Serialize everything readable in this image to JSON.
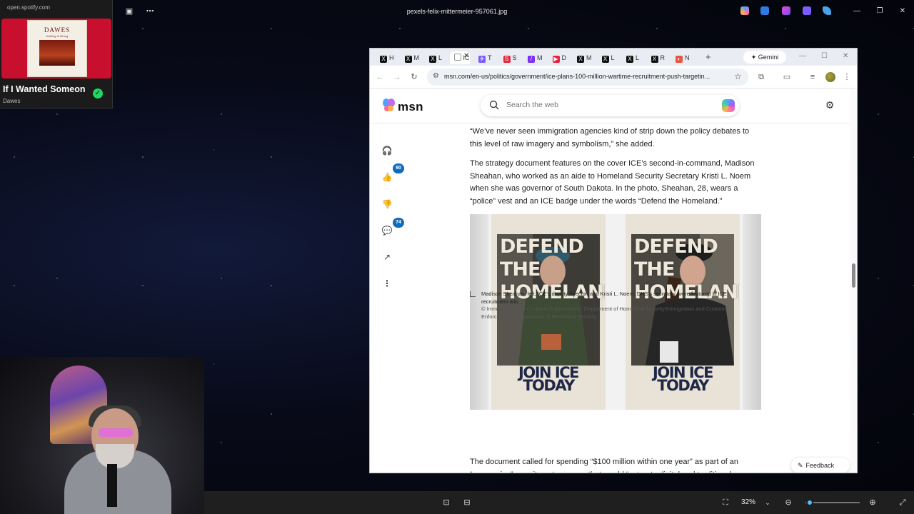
{
  "spotify": {
    "origin": "open.spotify.com",
    "album_band": "DAWES",
    "album_subtitle": "Nothing Is Wrong",
    "track": "If I Wanted Someone",
    "artist": "Dawes"
  },
  "viewer": {
    "file_title": "pexels-felix-mittermeier-957061.jpg",
    "zoom": "32%",
    "zoom_fraction": 0.08
  },
  "browser": {
    "tabs": [
      {
        "icon": "X",
        "label": "H"
      },
      {
        "icon": "X",
        "label": "M"
      },
      {
        "icon": "X",
        "label": "L"
      },
      {
        "icon": "",
        "label": "IC",
        "active": true
      },
      {
        "icon": "✈",
        "label": "T"
      },
      {
        "icon": "S",
        "label": "S"
      },
      {
        "icon": "/",
        "label": "M"
      },
      {
        "icon": "▶",
        "label": "D"
      },
      {
        "icon": "X",
        "label": "M"
      },
      {
        "icon": "X",
        "label": "L"
      },
      {
        "icon": "X",
        "label": "L"
      },
      {
        "icon": "X",
        "label": "R"
      },
      {
        "icon": "◐",
        "label": "N"
      }
    ],
    "gemini_label": "Gemini",
    "url": "msn.com/en-us/politics/government/ice-plans-100-million-wartime-recruitment-push-targetin..."
  },
  "msn": {
    "logo_text": "msn",
    "search_placeholder": "Search the web",
    "rail": {
      "like_count": "90",
      "comment_count": "74"
    },
    "article": {
      "p1": "“We’ve never seen immigration agencies kind of strip down the policy debates to this level of raw imagery and symbolism,” she added.",
      "p2": "The strategy document features on the cover ICE’s second-in-command, Madison Sheahan, who worked as an aide to Homeland Security Secretary Kristi L. Noem when she was governor of South Dakota. In the photo, Sheahan, 28, wears a “police” vest and an ICE badge under the words “Defend the Homeland.”",
      "poster_headline": "DEFEND THE HOMELAND",
      "poster_cta": "JOIN ICE TODAY",
      "poster_badge": "ICE",
      "caption": "Madison Sheahan, left, ICE’s deputy director, and Kristi L. Noem, DHS’s secretary, were featured in ICE recruitment ads.",
      "credit": "© Immigration and Customs Enforcement ; Department of Homeland Security/Immigration and Customs Enforcement ; Department of Homeland Security",
      "p3": "The document called for spending “$100 million within one year” as part of an “aggressive” recruitment program that would “saturate digital and traditional"
    },
    "feedback_label": "Feedback"
  }
}
